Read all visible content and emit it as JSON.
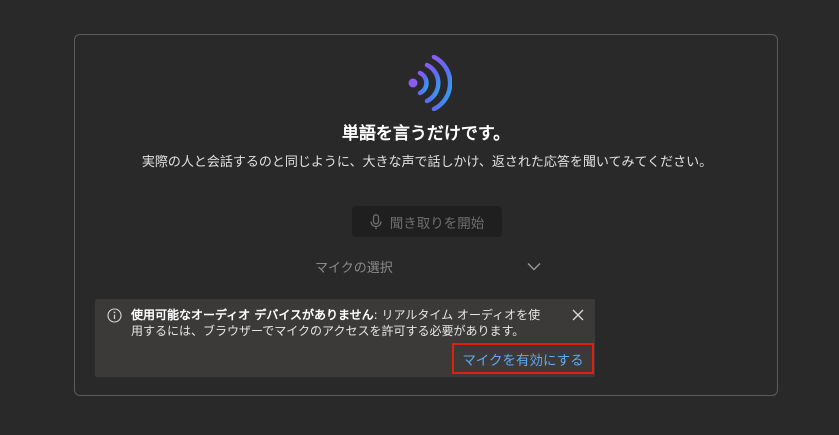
{
  "hero": {
    "headline": "単語を言うだけです。",
    "description": "実際の人と会話するのと同じように、大きな声で話しかけ、返された応答を聞いてみてください。"
  },
  "controls": {
    "listen_button_label": "聞き取りを開始",
    "mic_select_label": "マイクの選択"
  },
  "notice": {
    "title": "使用可能なオーディオ デバイスがありません",
    "message": ": リアルタイム オーディオを使用するには、ブラウザーでマイクのアクセスを許可する必要があります。",
    "action_label": "マイクを有効にする"
  },
  "colors": {
    "background": "#292929",
    "card_border": "#5c5c5c",
    "notice_bg": "#3b3a39",
    "link": "#60a8f0",
    "highlight_border": "#e0200f"
  },
  "icons": {
    "logo": "audio-waves-icon",
    "listen": "microphone-icon",
    "select": "chevron-down-icon",
    "notice": "info-icon",
    "dismiss": "close-icon"
  }
}
